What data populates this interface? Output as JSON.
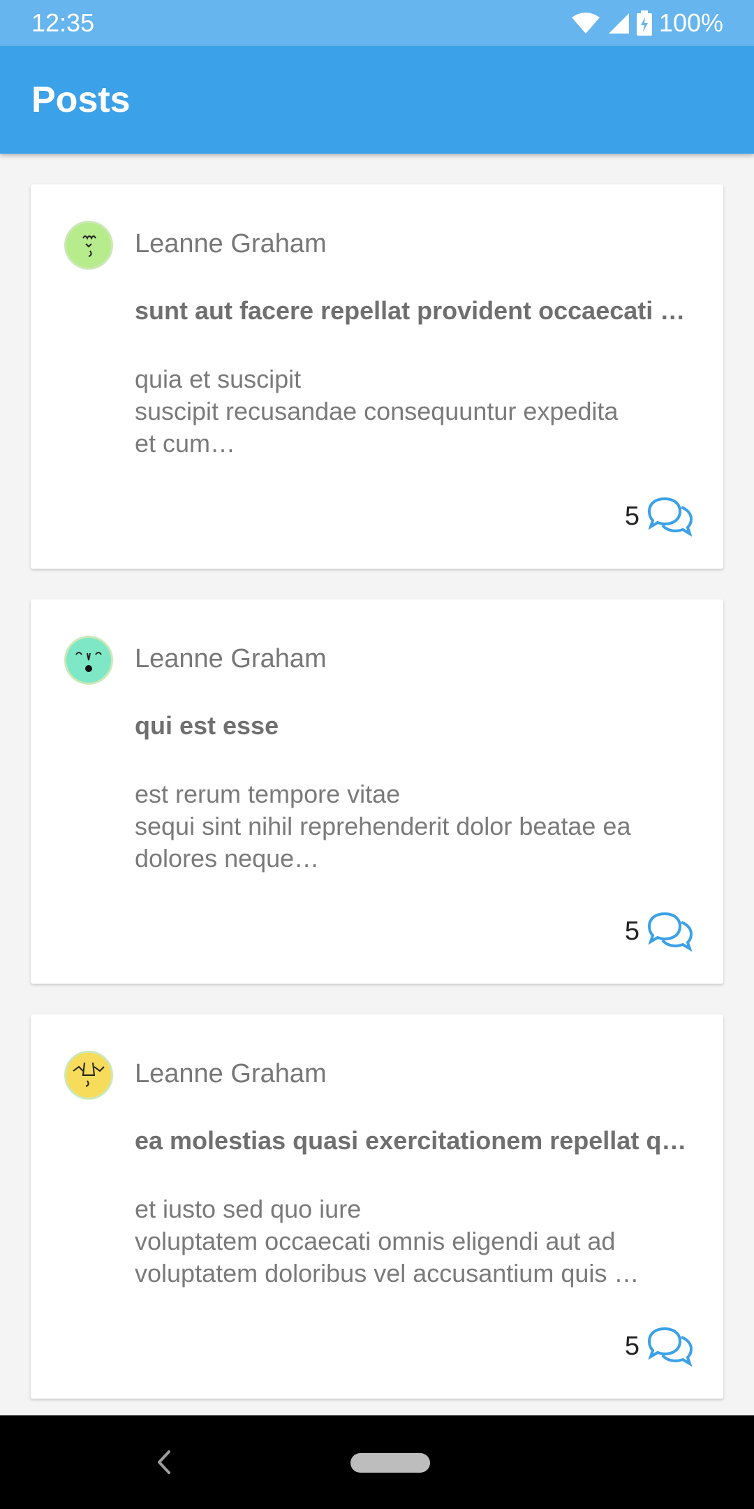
{
  "status_bar": {
    "time": "12:35",
    "battery": "100%",
    "icons": [
      "wifi-icon",
      "signal-icon",
      "battery-icon"
    ]
  },
  "app_bar": {
    "title": "Posts"
  },
  "posts": [
    {
      "author": "Leanne Graham",
      "title": "sunt aut facere repellat provident occaecati …",
      "body": "quia et suscipit\nsuscipit recusandae consequuntur expedita\net cum…",
      "comments": "5",
      "avatar_color": "#b6ec8b"
    },
    {
      "author": "Leanne Graham",
      "title": "qui est esse",
      "body": "est rerum tempore vitae\nsequi sint nihil reprehenderit dolor beatae ea\ndolores neque…",
      "comments": "5",
      "avatar_color": "#7ee8c6"
    },
    {
      "author": "Leanne Graham",
      "title": "ea molestias quasi exercitationem repellat q…",
      "body": "et iusto sed quo iure\nvoluptatem occaecati omnis eligendi aut ad\nvoluptatem doloribus vel accusantium quis …",
      "comments": "5",
      "avatar_color": "#f6dc5a"
    }
  ],
  "colors": {
    "app_bar": "#3ba1e8",
    "status_bar": "#66b5ee",
    "accent": "#3ba1e8"
  }
}
